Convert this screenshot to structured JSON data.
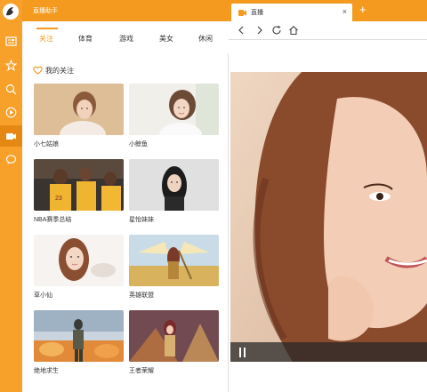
{
  "app": {
    "title": "直播助手"
  },
  "tabs": [
    {
      "label": "关注",
      "active": true
    },
    {
      "label": "体育",
      "active": false
    },
    {
      "label": "游戏",
      "active": false
    },
    {
      "label": "美女",
      "active": false
    },
    {
      "label": "休闲",
      "active": false
    }
  ],
  "section": {
    "title": "我的关注"
  },
  "cards": [
    {
      "label": "小七姑娘"
    },
    {
      "label": "小鲸鱼"
    },
    {
      "label": "NBA赛季总结"
    },
    {
      "label": "星怡妹妹"
    },
    {
      "label": "草小仙"
    },
    {
      "label": "英雄联盟"
    },
    {
      "label": "绝地求生"
    },
    {
      "label": "王者荣耀"
    }
  ],
  "browser": {
    "tab_title": "直播",
    "tab_close": "×",
    "new_tab": "+"
  },
  "colors": {
    "accent": "#f39a1f",
    "sidebar": "#f7a02a"
  },
  "icons": [
    "logo-icon",
    "news-icon",
    "star-icon",
    "search-icon",
    "play-icon",
    "video-icon",
    "chat-icon",
    "heart-icon",
    "back-icon",
    "forward-icon",
    "refresh-icon",
    "home-icon",
    "pause-icon"
  ]
}
